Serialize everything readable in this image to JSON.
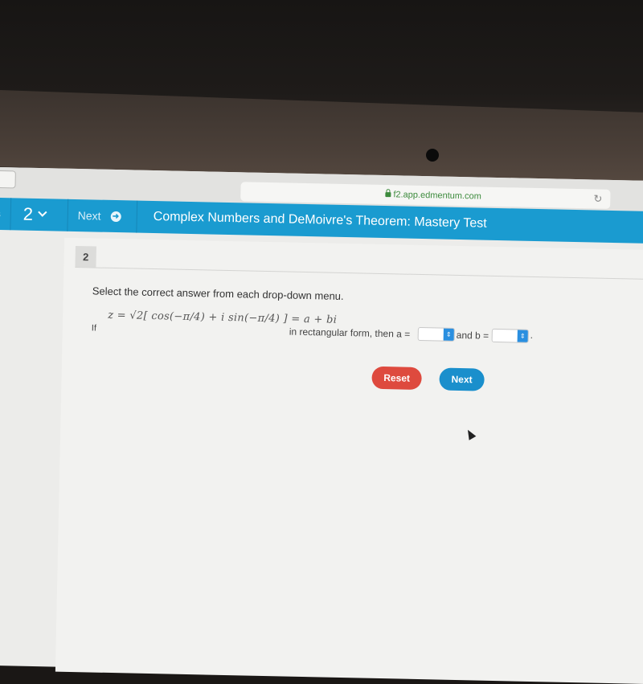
{
  "browser": {
    "url": "f2.app.edmentum.com",
    "lock_icon": "lock-icon",
    "reload_icon": "↻"
  },
  "nav": {
    "prev_fragment": "s",
    "question_number": "2",
    "next_label": "Next",
    "next_icon": "➜",
    "title": "Complex Numbers and DeMoivre's Theorem: Mastery Test"
  },
  "question": {
    "number": "2",
    "instruction": "Select the correct answer from each drop-down menu.",
    "if_label": "If",
    "expression": "z = √2[ cos(−π/4) + i sin(−π/4) ] = a + bi",
    "after_text": "in rectangular form, then a =",
    "and_text": "and b =",
    "period": ".",
    "dropdown_a": {
      "selected": ""
    },
    "dropdown_b": {
      "selected": ""
    }
  },
  "buttons": {
    "reset_label": "Reset",
    "next_label": "Next"
  },
  "colors": {
    "nav_blue": "#1a9bd0",
    "reset_red": "#de4a3e",
    "next_blue": "#1a8fcc",
    "url_green": "#3d8b3d"
  }
}
